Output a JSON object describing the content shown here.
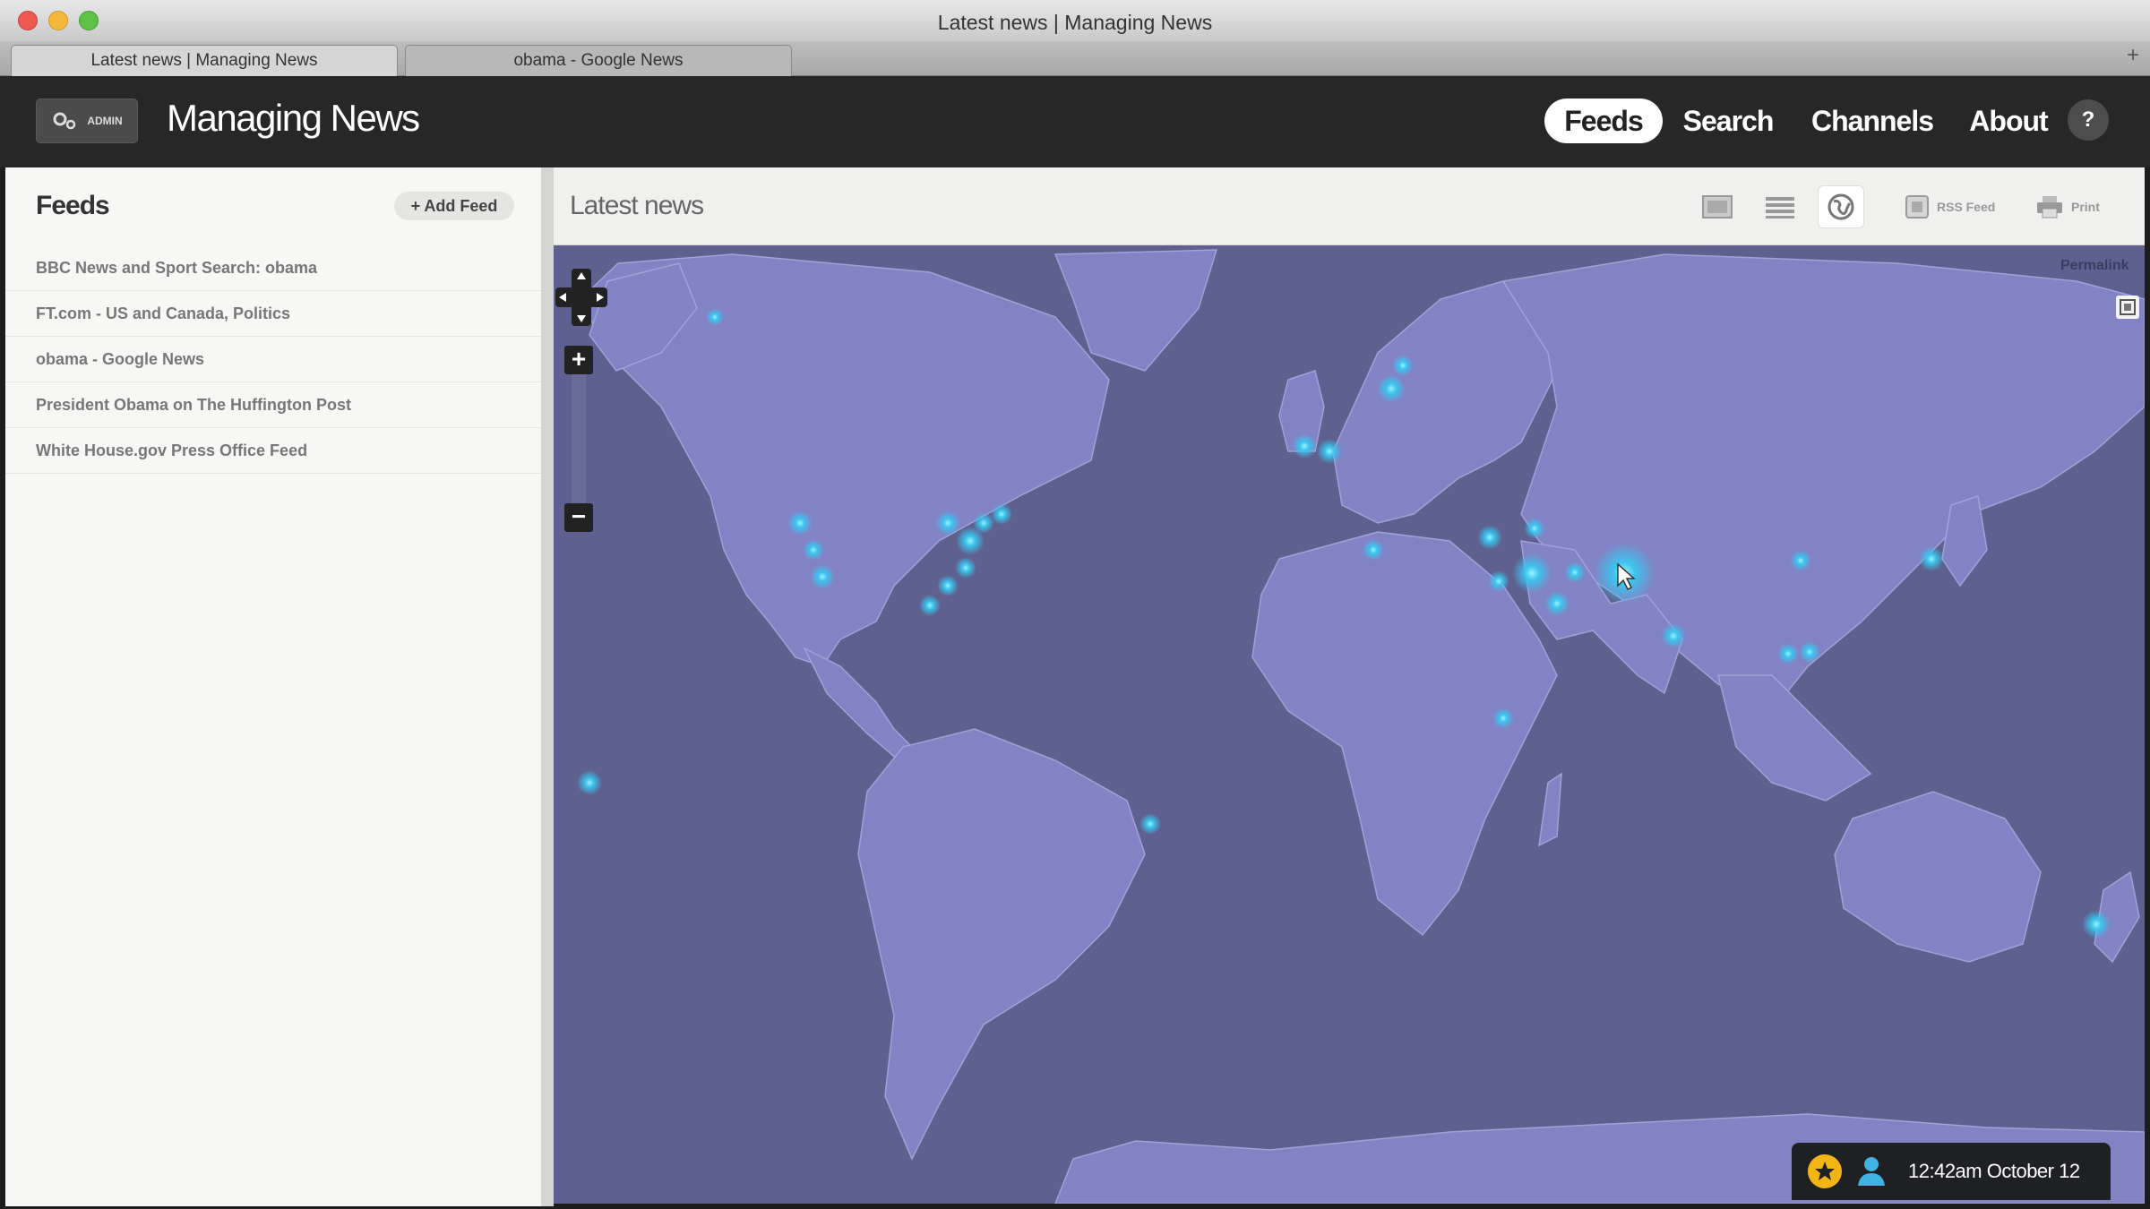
{
  "window": {
    "title": "Latest news | Managing News",
    "tabs": [
      {
        "label": "Latest news | Managing News"
      },
      {
        "label": "obama - Google News"
      }
    ],
    "new_tab": "+"
  },
  "header": {
    "admin_label": "ADMIN",
    "brand": "Managing News",
    "nav": [
      {
        "label": "Feeds",
        "active": true
      },
      {
        "label": "Search"
      },
      {
        "label": "Channels"
      },
      {
        "label": "About"
      }
    ],
    "help": "?"
  },
  "sidebar": {
    "title": "Feeds",
    "add_button": "+ Add Feed",
    "feeds": [
      {
        "label": "BBC News and Sport Search: obama"
      },
      {
        "label": "FT.com - US and Canada, Politics"
      },
      {
        "label": "obama - Google News"
      },
      {
        "label": "President Obama on The Huffington Post"
      },
      {
        "label": "White House.gov Press Office Feed"
      }
    ]
  },
  "content": {
    "title": "Latest news",
    "views": [
      "single-view-icon",
      "list-view-icon",
      "globe-view-icon"
    ],
    "active_view": "map",
    "actions": [
      {
        "label": "RSS Feed",
        "icon": "rss-icon"
      },
      {
        "label": "Print",
        "icon": "printer-icon"
      }
    ]
  },
  "map": {
    "permalink": "Permalink",
    "zoom_in": "+",
    "zoom_out": "−",
    "colors": {
      "ocean": "#5e6090",
      "land": "#8183c4",
      "hotspot": "#38c8f0"
    }
  },
  "status": {
    "time": "12:42am October 12"
  }
}
